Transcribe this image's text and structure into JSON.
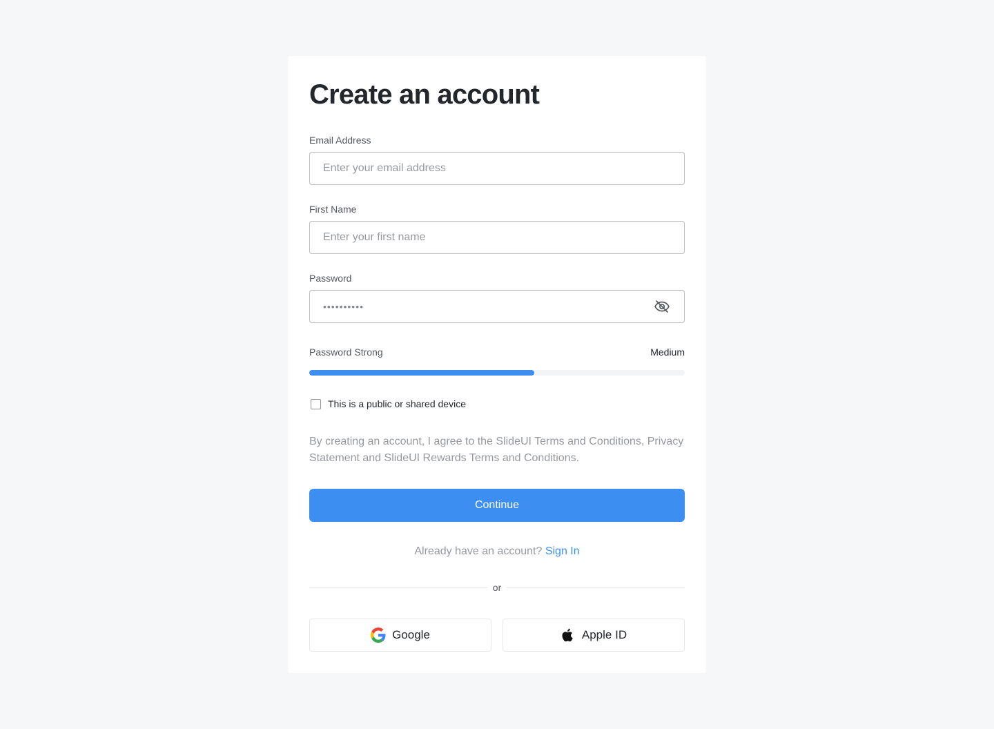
{
  "form": {
    "title": "Create an account",
    "email": {
      "label": "Email Address",
      "placeholder": "Enter your email address",
      "value": ""
    },
    "first_name": {
      "label": "First Name",
      "placeholder": "Enter your first name",
      "value": ""
    },
    "password": {
      "label": "Password",
      "masked_value": "••••••••••",
      "visibility_icon": "eye-off-icon"
    },
    "strength": {
      "label": "Password Strong",
      "value_label": "Medium",
      "level_percent": 60,
      "color": "#3c8ff0"
    },
    "shared_device": {
      "label": "This is a public or shared device",
      "checked": false
    },
    "terms_text": "By creating an account, I agree to the SlideUI Terms and Conditions, Privacy Statement and SlideUI Rewards Terms and Conditions.",
    "continue_label": "Continue",
    "signin_prompt": "Already have an account?",
    "signin_link": "Sign In",
    "divider_text": "or",
    "social": {
      "google_label": "Google",
      "apple_label": "Apple ID"
    }
  },
  "colors": {
    "background": "#f6f7f9",
    "accent": "#3c8ff0"
  }
}
